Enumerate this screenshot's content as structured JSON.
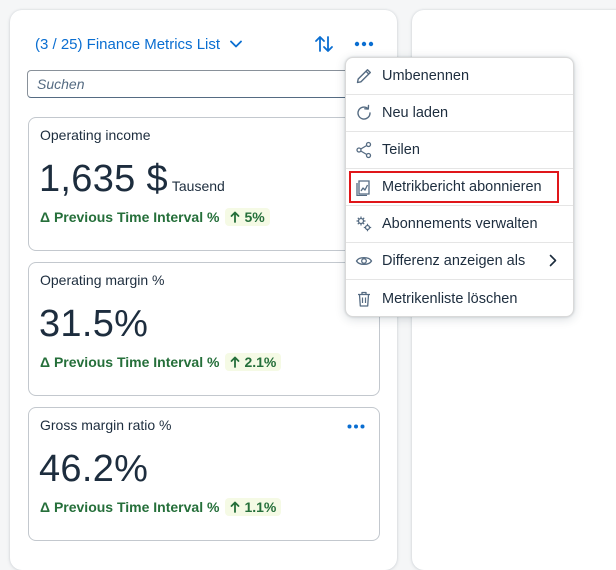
{
  "header": {
    "title": "(3 / 25) Finance Metrics List",
    "icons": {
      "dropdown": "chevron-down-icon",
      "sort": "sort-arrows-icon",
      "more": "more-icon"
    }
  },
  "search": {
    "placeholder": "Suchen",
    "value": ""
  },
  "cards": [
    {
      "title": "Operating income",
      "value": "1,635 $",
      "unit": "Tausend",
      "delta_label": "Δ Previous Time Interval %",
      "delta_value": "5%"
    },
    {
      "title": "Operating margin %",
      "value": "31.5%",
      "unit": "",
      "delta_label": "Δ Previous Time Interval %",
      "delta_value": "2.1%"
    },
    {
      "title": "Gross margin ratio %",
      "value": "46.2%",
      "unit": "",
      "delta_label": "Δ Previous Time Interval %",
      "delta_value": "1.1%"
    }
  ],
  "menu": {
    "items": [
      {
        "label": "Umbenennen",
        "icon": "pencil-icon"
      },
      {
        "label": "Neu laden",
        "icon": "refresh-icon"
      },
      {
        "label": "Teilen",
        "icon": "share-icon"
      },
      {
        "label": "Metrikbericht abonnieren",
        "icon": "subscribe-report-icon",
        "highlighted": true
      },
      {
        "label": "Abonnements verwalten",
        "icon": "gears-icon"
      },
      {
        "label": "Differenz anzeigen als",
        "icon": "eye-icon",
        "has_submenu": true
      },
      {
        "label": "Metrikenliste löschen",
        "icon": "trash-icon"
      }
    ]
  },
  "colors": {
    "accent": "#0a6ed1",
    "positive": "#256f3a",
    "positive_bg": "#f5fae5",
    "highlight_border": "#e0161a"
  }
}
